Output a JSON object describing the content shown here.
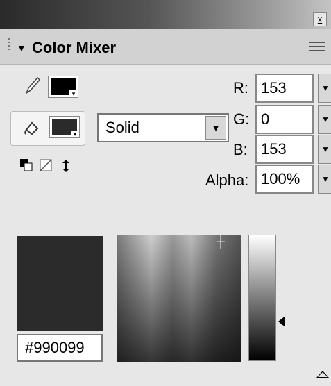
{
  "window": {
    "close_glyph": "x"
  },
  "panel": {
    "title": "Color Mixer",
    "collapse_glyph": "▼"
  },
  "fill": {
    "type_value": "Solid"
  },
  "rgba": {
    "r_label": "R:",
    "r_value": "153",
    "g_label": "G:",
    "g_value": "0",
    "b_label": "B:",
    "b_value": "153",
    "alpha_label": "Alpha:",
    "alpha_value": "100%"
  },
  "hex_value": "#990099",
  "icons": {
    "stroke": "pencil-icon",
    "fill": "paint-bucket-icon",
    "black_white": "black-white-swatches-icon",
    "no_color": "no-color-icon",
    "swap": "swap-colors-icon",
    "panel_menu": "panel-menu-icon"
  },
  "colors": {
    "current_swatch": "#2b2b2b"
  }
}
